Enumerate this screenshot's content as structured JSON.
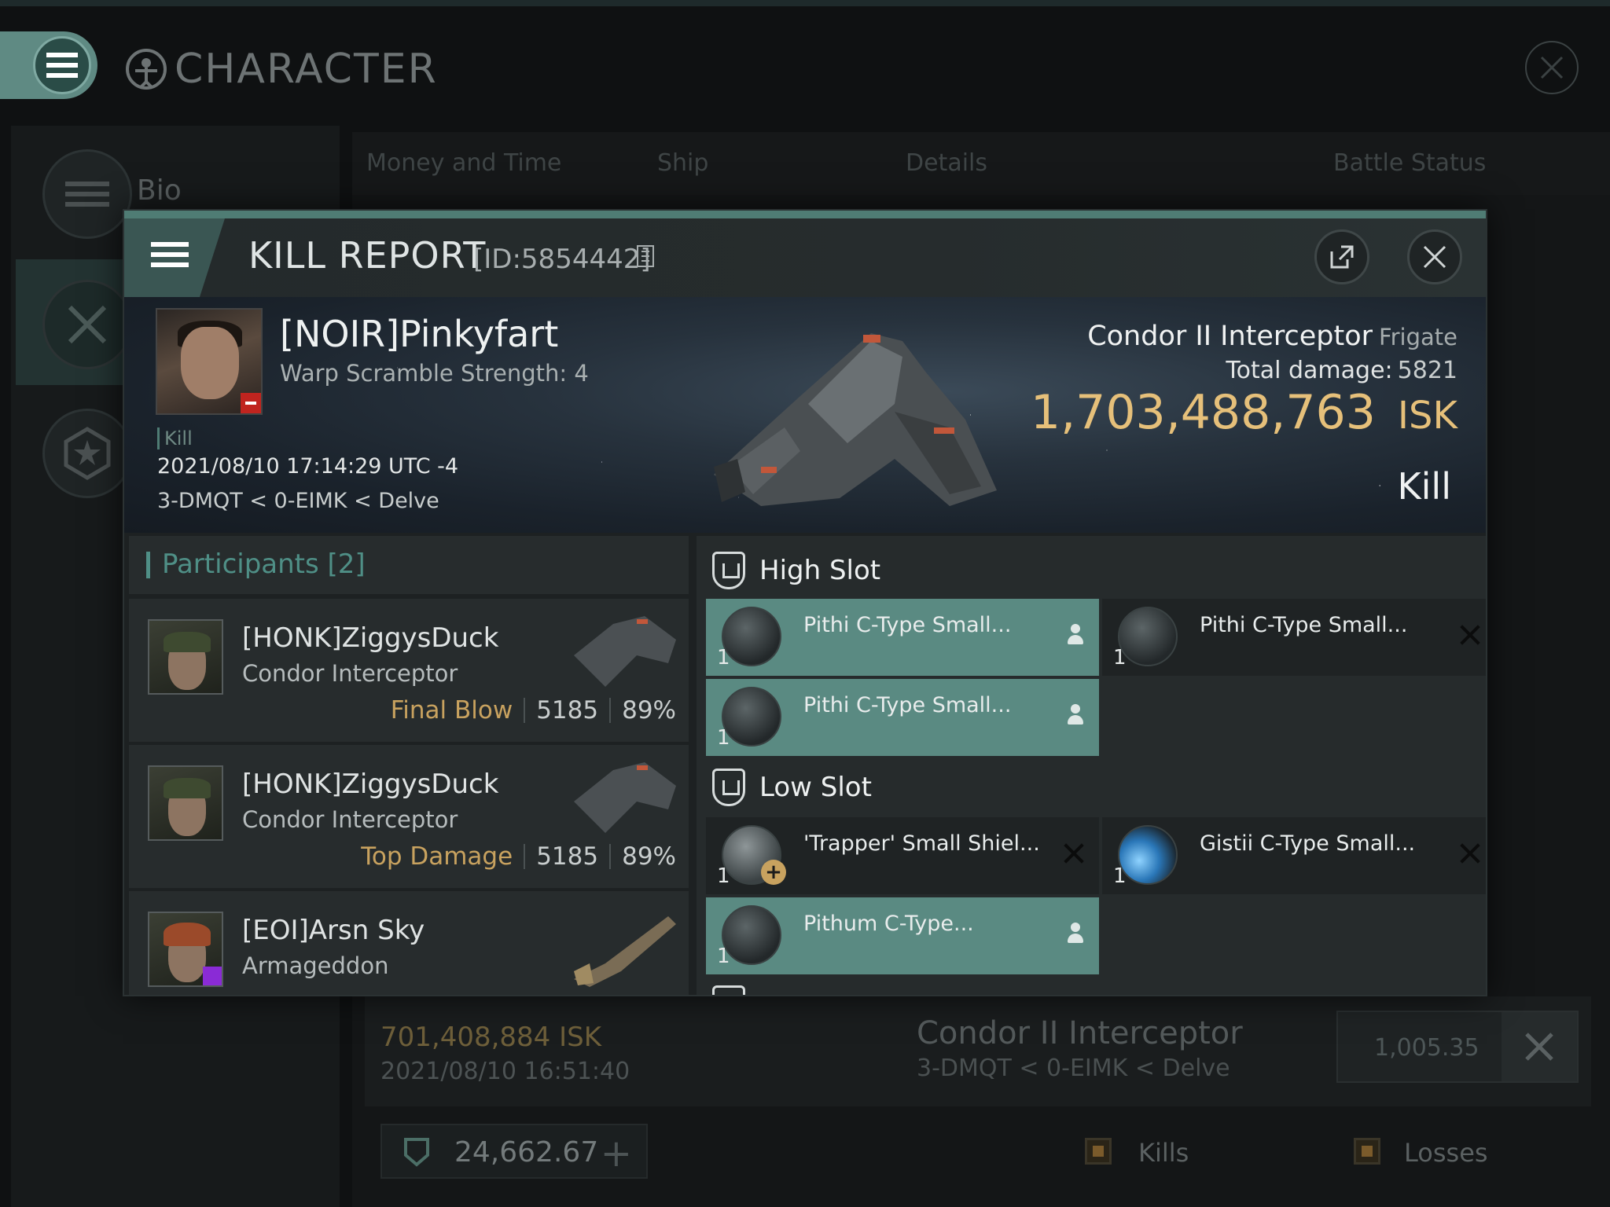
{
  "header": {
    "title": "CHARACTER"
  },
  "sidebar": {
    "items": [
      {
        "label": "Bio"
      }
    ]
  },
  "bg_tabs": [
    "Money and Time",
    "Ship",
    "Details",
    "Battle Status"
  ],
  "bg_record": {
    "isk": "701,408,884 ISK",
    "date": "2021/08/10 16:51:40",
    "ship": "Condor II Interceptor",
    "location": "3-DMQT < 0-EIMK < Delve",
    "plex_value": "1,005.35"
  },
  "bg_footer": {
    "plex_balance": "24,662.67",
    "legend_kills": "Kills",
    "legend_losses": "Losses"
  },
  "kill_report": {
    "title": "KILL REPORT",
    "id": "[ID:5854442]",
    "victim": {
      "name": "[NOIR]Pinkyfart",
      "warp_scramble": "Warp Scramble Strength: 4",
      "kill_tag": "Kill",
      "datetime": "2021/08/10 17:14:29 UTC -4",
      "location": "3-DMQT < 0-EIMK < Delve"
    },
    "ship": {
      "name": "Condor II Interceptor",
      "class": "Frigate",
      "total_damage_label": "Total damage:",
      "total_damage": "5821",
      "isk_value": "1,703,488,763",
      "isk_unit": "ISK",
      "result": "Kill"
    },
    "participants": {
      "label": "Participants",
      "count": "[2]",
      "rows": [
        {
          "name": "[HONK]ZiggysDuck",
          "ship": "Condor Interceptor",
          "role": "Final Blow",
          "damage": "5185",
          "percent": "89%"
        },
        {
          "name": "[HONK]ZiggysDuck",
          "ship": "Condor Interceptor",
          "role": "Top Damage",
          "damage": "5185",
          "percent": "89%"
        },
        {
          "name": "[EOI]Arsn Sky",
          "ship": "Armageddon"
        }
      ]
    },
    "fitting": {
      "high_slot_label": "High Slot",
      "low_slot_label": "Low Slot",
      "high_slot": [
        {
          "name": "Pithi C-Type Small...",
          "qty": "1",
          "status": "dropped"
        },
        {
          "name": "Pithi C-Type Small...",
          "qty": "1",
          "status": "destroyed"
        },
        {
          "name": "Pithi C-Type Small...",
          "qty": "1",
          "status": "dropped"
        }
      ],
      "low_slot": [
        {
          "name": "'Trapper' Small Shiel...",
          "qty": "1",
          "status": "destroyed"
        },
        {
          "name": "Gistii C-Type Small...",
          "qty": "1",
          "status": "destroyed"
        },
        {
          "name": "Pithum C-Type...",
          "qty": "1",
          "status": "dropped"
        }
      ]
    }
  },
  "colors": {
    "accent": "#4f7c74",
    "isk_gold": "#e6c07a",
    "role_gold": "#c8a25f",
    "dropped_bg": "#5a8a82"
  }
}
